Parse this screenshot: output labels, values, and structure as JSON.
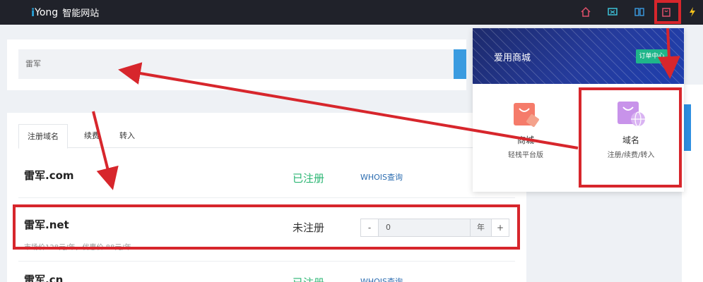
{
  "app": {
    "logo_i": "i",
    "logo_yong": "Yong",
    "logo_name": "智能网站"
  },
  "search": {
    "value": "雷军"
  },
  "tabs": [
    {
      "label": "注册域名"
    },
    {
      "label": "续费"
    },
    {
      "label": "转入"
    }
  ],
  "results": [
    {
      "domain": "雷军.com",
      "status": "已注册",
      "action": "WHOIS查询"
    },
    {
      "domain": "雷军.net",
      "status": "未注册",
      "price_note": "市场价128元/年，优惠价 88元/年",
      "years": "0",
      "unit": "年",
      "minus": "-",
      "plus": "+"
    },
    {
      "domain": "雷军.cn",
      "status": "已注册",
      "action": "WHOIS查询"
    }
  ],
  "store_panel": {
    "title": "爱用商城",
    "order_button": "订单中心",
    "services": [
      {
        "name": "商城",
        "desc": "轻栈平台版",
        "icon": "shopping-bag-icon"
      },
      {
        "name": "域名",
        "desc": "注册/续费/转入",
        "icon": "globe-bag-icon"
      }
    ]
  },
  "colors": {
    "topbar": "#20222a",
    "accent_blue": "#3a9be0",
    "registered_green": "#2bb673",
    "order_green": "#1fb58a",
    "annotation_red": "#d7262c"
  }
}
